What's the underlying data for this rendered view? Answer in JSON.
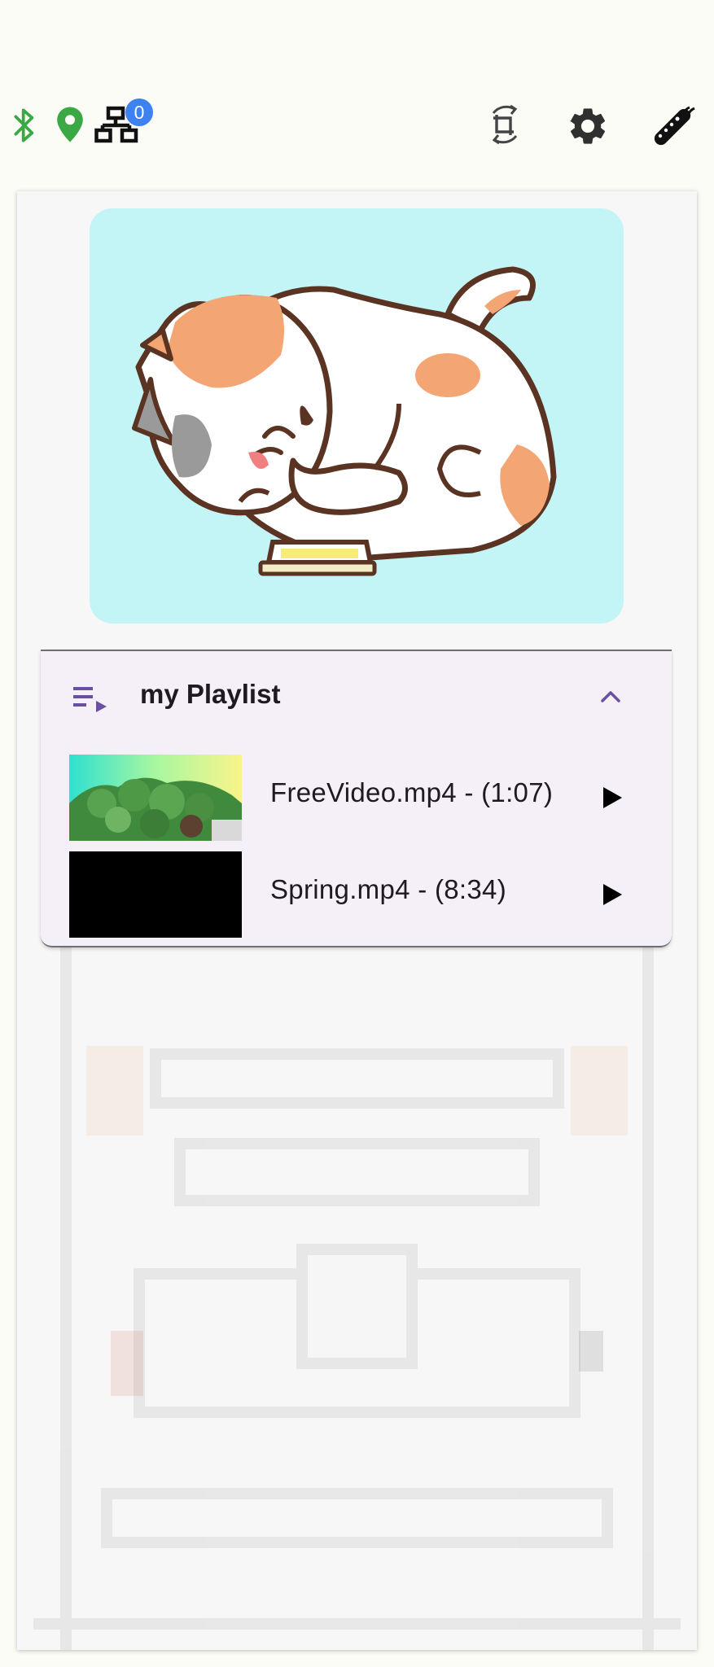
{
  "status_bar": {
    "icons": [
      "bluetooth-icon",
      "location-pin-icon",
      "network-icon"
    ],
    "network_badge_count": "0",
    "colors": {
      "bluetooth": "#3aa845",
      "location": "#3aa845",
      "badge": "#3d82f0"
    }
  },
  "toolbar": {
    "actions": [
      "crop-rotate-icon",
      "settings-gear-icon",
      "remote-control-icon"
    ]
  },
  "hero": {
    "image": "cat-cartoon-illustration",
    "background": "#c3f4f6"
  },
  "playlist": {
    "title": "my Playlist",
    "icon": "playlist-play-icon",
    "expanded": true,
    "accent": "#6b4fa3",
    "items": [
      {
        "label": "FreeVideo.mp4 - (1:07)",
        "thumbnail": "nature-video-thumbnail"
      },
      {
        "label": "Spring.mp4 - (8:34)",
        "thumbnail": "black-thumbnail"
      }
    ]
  },
  "background": {
    "image": "faded-pixel-art-watermark"
  }
}
